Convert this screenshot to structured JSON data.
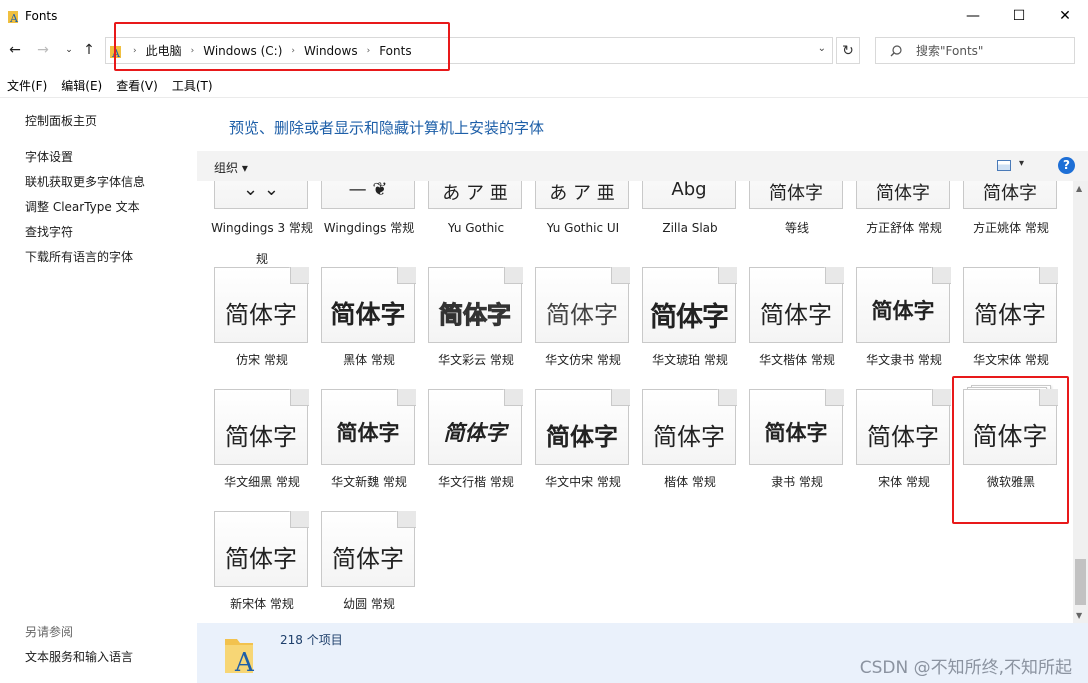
{
  "window": {
    "title": "Fonts",
    "minimize": "—",
    "maximize": "☐",
    "close": "✕"
  },
  "address": {
    "crumbs": [
      "此电脑",
      "Windows (C:)",
      "Windows",
      "Fonts"
    ],
    "search_placeholder": "搜索\"Fonts\""
  },
  "menu": [
    "文件(F)",
    "编辑(E)",
    "查看(V)",
    "工具(T)"
  ],
  "left_pane": {
    "links": [
      "控制面板主页",
      "字体设置",
      "联机获取更多字体信息",
      "调整 ClearType 文本",
      "查找字符",
      "下载所有语言的字体"
    ],
    "see_also_heading": "另请参阅",
    "see_also_links": [
      "文本服务和输入语言"
    ]
  },
  "main": {
    "heading": "预览、删除或者显示和隐藏计算机上安装的字体",
    "organize_label": "组织 ▾",
    "help": "?",
    "fonts_row1": [
      {
        "sample": "",
        "label": "Wingdings 3 常规",
        "label2": "规"
      },
      {
        "sample": "",
        "label": "Wingdings 常规"
      },
      {
        "sample": "",
        "label": "Yu Gothic"
      },
      {
        "sample": "",
        "label": "Yu Gothic UI"
      },
      {
        "sample": "",
        "label": "Zilla Slab"
      },
      {
        "sample": "",
        "label": "等线"
      },
      {
        "sample": "",
        "label": "方正舒体 常规"
      },
      {
        "sample": "",
        "label": "方正姚体 常规"
      }
    ],
    "fonts_row2": [
      {
        "sample": "简体字",
        "label": "仿宋 常规"
      },
      {
        "sample": "简体字",
        "label": "黑体 常规"
      },
      {
        "sample": "简体字",
        "label": "华文彩云 常规"
      },
      {
        "sample": "简体字",
        "label": "华文仿宋 常规"
      },
      {
        "sample": "简体字",
        "label": "华文琥珀 常规"
      },
      {
        "sample": "简体字",
        "label": "华文楷体 常规"
      },
      {
        "sample": "简体字",
        "label": "华文隶书 常规"
      },
      {
        "sample": "简体字",
        "label": "华文宋体 常规"
      }
    ],
    "fonts_row3": [
      {
        "sample": "简体字",
        "label": "华文细黑 常规"
      },
      {
        "sample": "简体字",
        "label": "华文新魏 常规"
      },
      {
        "sample": "简体字",
        "label": "华文行楷 常规"
      },
      {
        "sample": "简体字",
        "label": "华文中宋 常规"
      },
      {
        "sample": "简体字",
        "label": "楷体 常规"
      },
      {
        "sample": "简体字",
        "label": "隶书 常规"
      },
      {
        "sample": "简体字",
        "label": "宋体 常规"
      },
      {
        "sample": "简体字",
        "label": "微软雅黑"
      }
    ],
    "fonts_row4": [
      {
        "sample": "简体字",
        "label": "新宋体 常规"
      },
      {
        "sample": "简体字",
        "label": "幼圆 常规"
      }
    ]
  },
  "status": {
    "item_count": "218 个项目"
  },
  "watermark": "CSDN @不知所终,不知所起",
  "colors": {
    "highlight": "#e8191a",
    "heading": "#1e5fa8",
    "status_bg": "#eaf1fb"
  }
}
